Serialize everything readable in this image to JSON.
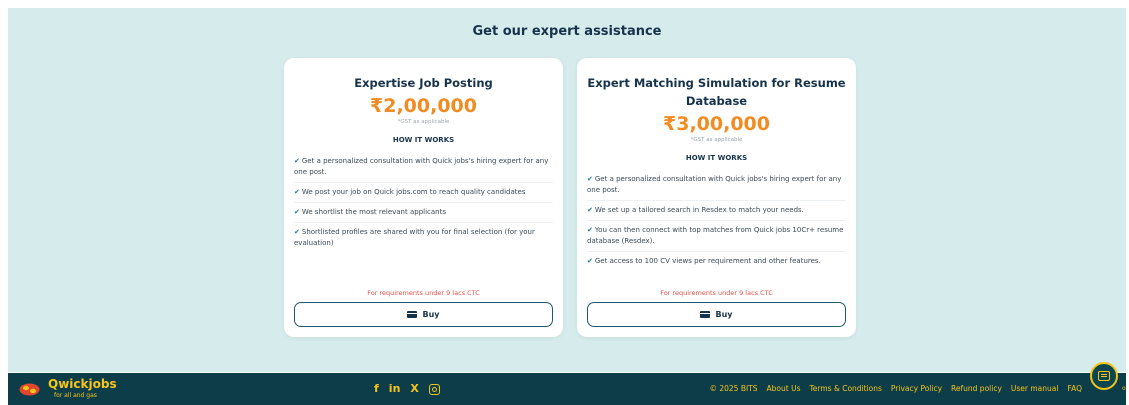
{
  "section": {
    "title": "Get our expert assistance"
  },
  "cards": [
    {
      "title": "Expertise Job Posting",
      "price": "₹2,00,000",
      "gst_note": "*GST as applicable",
      "how_it_works": "HOW IT WORKS",
      "features": [
        "Get a personalized consultation with Quick jobs's hiring expert for any one post.",
        "We post your job on Quick jobs.com to reach quality candidates",
        "We shortlist the most relevant applicants",
        "Shortlisted profiles are shared with you for final selection (for your evaluation)"
      ],
      "requirement_note": "For requirements under 9 lacs CTC",
      "buy_label": "Buy"
    },
    {
      "title": "Expert Matching Simulation for Resume Database",
      "price": "₹3,00,000",
      "gst_note": "*GST as applicable",
      "how_it_works": "HOW IT WORKS",
      "features": [
        "Get a personalized consultation with Quick jobs's hiring expert for any one post.",
        "We set up a tailored search in Resdex to match your needs.",
        "You can then connect with top matches from Quick jobs 10Cr+ resume database (Resdex).",
        "Get access to 100 CV views per requirement and other features."
      ],
      "requirement_note": "For requirements under 9 lacs CTC",
      "buy_label": "Buy"
    }
  ],
  "footer": {
    "brand": "Qwickjobs",
    "tagline": "for all and gas",
    "social_icons": [
      "facebook-icon",
      "linkedin-icon",
      "x-icon",
      "instagram-icon"
    ],
    "social_glyphs": {
      "facebook": "f",
      "linkedin": "in",
      "x": "X"
    },
    "links": [
      "© 2025 BITS",
      "About Us",
      "Terms & Conditions",
      "Privacy Policy",
      "Refund policy",
      "User manual",
      "FAQ"
    ],
    "chat_tail": "o"
  },
  "colors": {
    "section_bg": "#d6ecec",
    "footer_bg": "#0e3d4a",
    "price": "#f28c22",
    "accent_yellow": "#f5c518",
    "requirement_note": "#e0524a"
  }
}
